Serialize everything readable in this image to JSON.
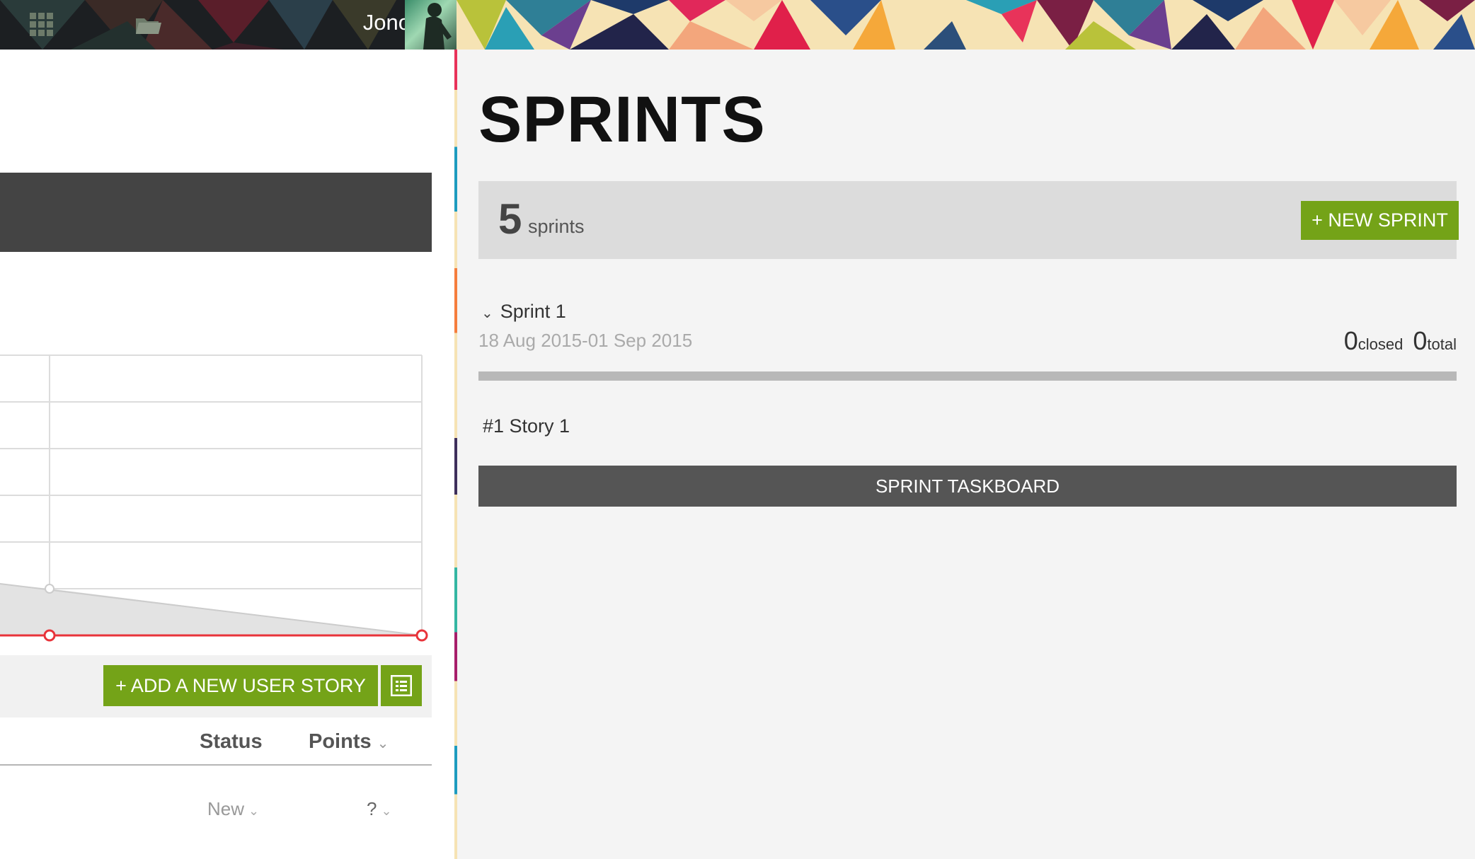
{
  "topbar": {
    "username": "Jono",
    "icons": {
      "apps": "apps-grid-icon",
      "projects": "folder-icon",
      "avatar": "user-avatar"
    }
  },
  "backlog": {
    "add_story_label": "+ ADD A NEW USER STORY",
    "bulk_icon": "bulk-list-icon",
    "columns": {
      "status": "Status",
      "points": "Points"
    },
    "row": {
      "status": "New",
      "points": "?"
    }
  },
  "sprints": {
    "title": "SPRINTS",
    "count": "5",
    "count_label": "sprints",
    "new_sprint_label": "+ NEW SPRINT",
    "items": [
      {
        "name": "Sprint 1",
        "dates": "18 Aug 2015-01 Sep 2015",
        "closed": "0",
        "closed_label": "closed",
        "total": "0",
        "total_label": "total",
        "progress": 0,
        "stories": [
          "#1 Story 1"
        ],
        "taskboard_label": "SPRINT TASKBOARD"
      }
    ]
  },
  "colors": {
    "accent_green": "#74a318",
    "dark_gray": "#555555",
    "burndown_red": "#e8333a"
  }
}
